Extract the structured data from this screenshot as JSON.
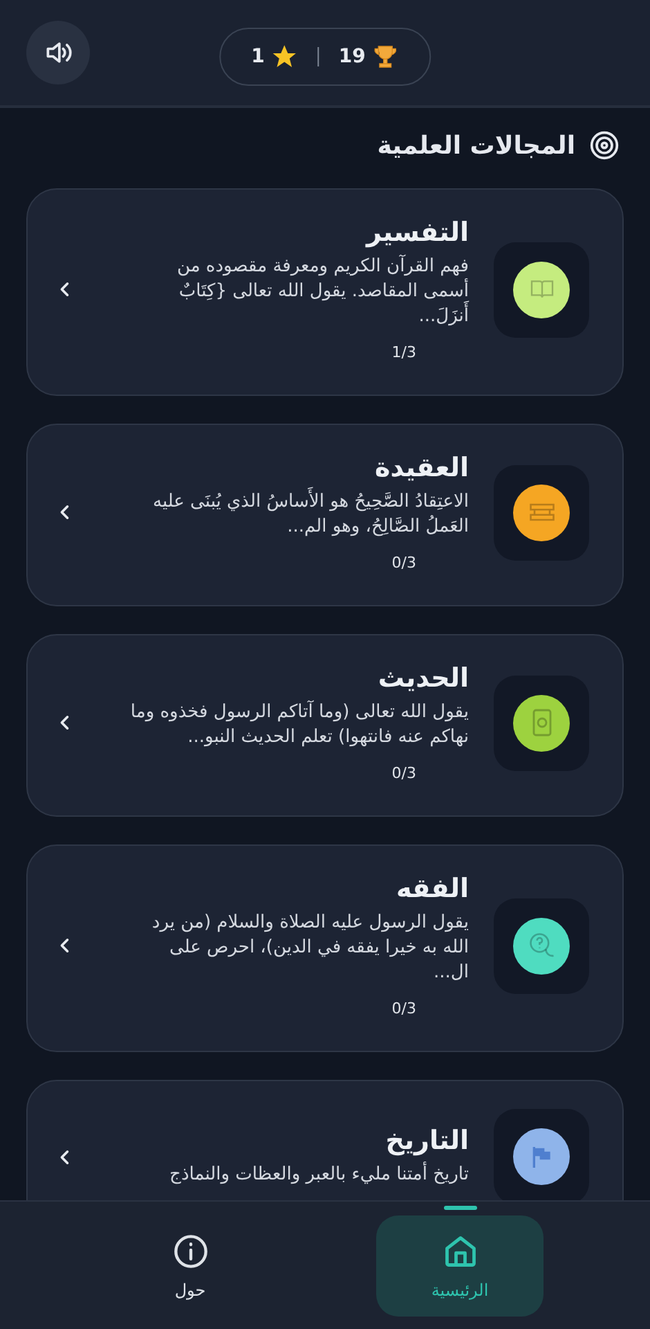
{
  "header": {
    "stats": [
      {
        "kind": "trophies",
        "value": "19"
      },
      {
        "kind": "stars",
        "value": "1"
      }
    ]
  },
  "section": {
    "title": "المجالات العلمية"
  },
  "cards": [
    {
      "title": "التفسير",
      "description": "فهم القرآن الكريم ومعرفة مقصوده من أسمى المقاصد. يقول الله تعالى {كِتَابٌ أَنزَلَ...",
      "progress": "1/3",
      "color": "#c5ec7f",
      "kind": "book"
    },
    {
      "title": "العقيدة",
      "description": "الاعتِقادُ الصَّحِيحُ هو الأَساسُ الذي يُبنَى عليه العَملُ الصَّالِحُ، وهو الم...",
      "progress": "0/3",
      "color": "#f5a623",
      "kind": "scroll"
    },
    {
      "title": "الحديث",
      "description": "يقول الله تعالى (وما آتاكم الرسول فخذوه وما نهاكم عنه فانتهوا) تعلم الحديث النبو...",
      "progress": "0/3",
      "color": "#9dd23f",
      "kind": "quran"
    },
    {
      "title": "الفقه",
      "description": "يقول الرسول عليه الصلاة والسلام (من يرد الله به خيرا يفقه في الدين)، احرص على ال...",
      "progress": "0/3",
      "color": "#4fdcc0",
      "kind": "question"
    },
    {
      "title": "التاريخ",
      "description": "تاريخ أمتنا مليء بالعبر والعظات والنماذج",
      "color": "#8fb4ea",
      "kind": "flag"
    }
  ],
  "nav": [
    {
      "label": "الرئيسية",
      "kind": "home",
      "selected": true
    },
    {
      "label": "حول",
      "kind": "about",
      "selected": false
    }
  ]
}
